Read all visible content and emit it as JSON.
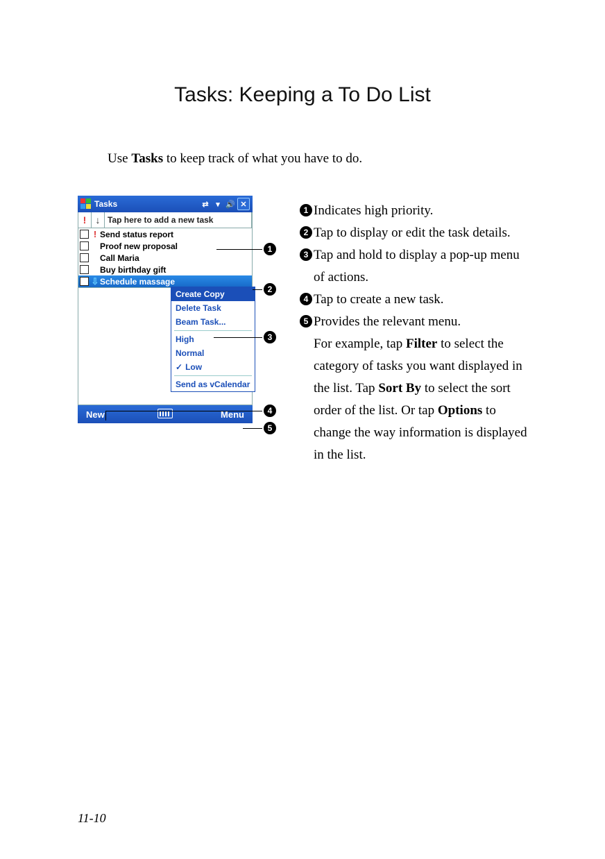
{
  "page": {
    "title": "Tasks: Keeping a To Do List",
    "intro_pre": "Use ",
    "intro_bold": "Tasks",
    "intro_post": " to keep track of what you have to do.",
    "page_number": "11-10"
  },
  "device": {
    "titlebar": "Tasks",
    "header_add": "Tap here to add a new task",
    "priority_mark": "!",
    "sort_mark": "↓",
    "tasks": [
      {
        "priority": "!",
        "name": "Send status report"
      },
      {
        "priority": "",
        "name": "Proof new proposal"
      },
      {
        "priority": "",
        "name": "Call Maria"
      },
      {
        "priority": "",
        "name": "Buy birthday gift"
      },
      {
        "priority": "⇩",
        "name": "Schedule massage"
      }
    ],
    "popup": {
      "create_copy": "Create Copy",
      "delete_task": "Delete Task",
      "beam_task": "Beam Task...",
      "high": "High",
      "normal": "Normal",
      "low": "Low",
      "send_vcal": "Send as vCalendar"
    },
    "menubar": {
      "new": "New",
      "menu": "Menu"
    }
  },
  "callouts": {
    "c1": {
      "n": "1",
      "text": "Indicates high priority."
    },
    "c2": {
      "n": "2",
      "text": "Tap to display or edit the task details."
    },
    "c3": {
      "n": "3",
      "text": "Tap and hold to display a pop-up menu of actions."
    },
    "c4": {
      "n": "4",
      "text": "Tap to create a new task."
    },
    "c5": {
      "n": "5",
      "t1": "Provides the relevant menu.",
      "t2a": "For example, tap ",
      "t2b": "Filter",
      "t2c": " to select the category of tasks you want displayed in the list. Tap ",
      "t2d": "Sort By",
      "t2e": " to select the sort order of the list. Or tap ",
      "t2f": "Options",
      "t2g": " to change the way information is displayed in the list."
    }
  }
}
